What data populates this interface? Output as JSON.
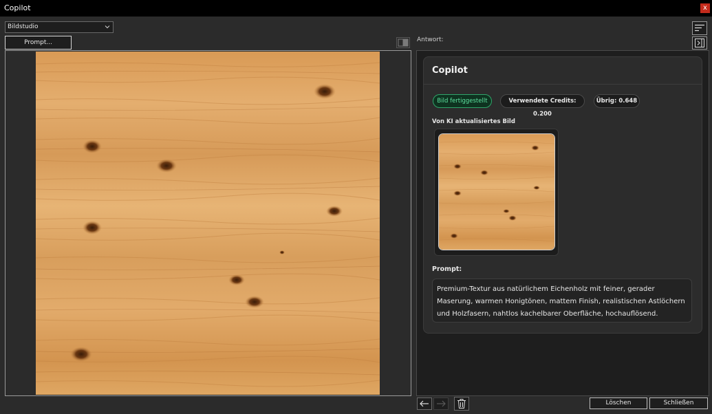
{
  "window": {
    "title": "Copilot",
    "close_glyph": "x"
  },
  "toolbar": {
    "mode_select": {
      "value": "Bildstudio",
      "icon": "chevron-down-icon"
    },
    "prompt_button": "Prompt...",
    "compare_icon": "compare-split-icon",
    "sort_icon": "sort-lines-icon",
    "panel_toggle_icon": "panel-collapse-icon"
  },
  "response": {
    "label": "Antwort:",
    "card": {
      "title": "Copilot",
      "badges": {
        "status": "Bild fertiggestellt",
        "credits_used": "Verwendete Credits: 0.200",
        "remaining": "Übrig: 0.648"
      },
      "image_label": "Von KI aktualisiertes Bild",
      "prompt_label": "Prompt:",
      "prompt_text": "Premium-Textur aus natürlichem Eichenholz mit feiner, gerader Maserung, warmen Honigtönen, mattem Finish, realistischen Astlöchern und Holzfasern, nahtlos kachelbarer Oberfläche, hochauflösend."
    }
  },
  "footer": {
    "back_icon": "arrow-left-icon",
    "forward_icon": "arrow-right-icon",
    "trash_icon": "trash-icon",
    "delete_label": "Löschen",
    "close_label": "Schließen"
  },
  "colors": {
    "background": "#2b2b2b",
    "pane": "#1e1e1e",
    "card": "#2c2c2c",
    "status_green": "#5fe3a1",
    "close_red": "#c42b1c",
    "wood_light": "#e3ad6d",
    "wood_dark": "#b87233"
  }
}
